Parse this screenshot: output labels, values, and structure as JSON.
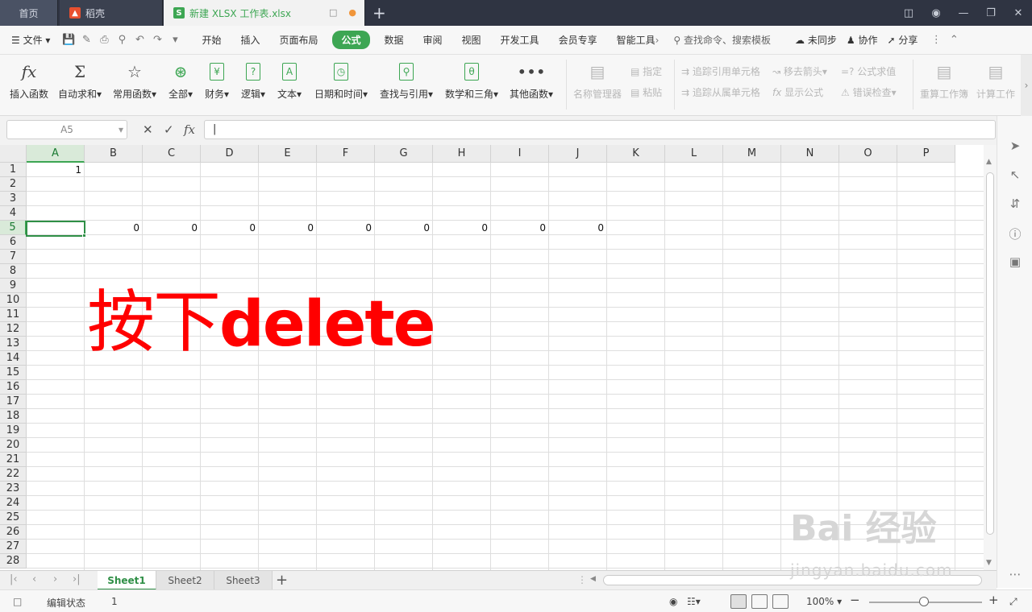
{
  "tabs": {
    "home": "首页",
    "daoke": "稻壳",
    "file": "新建 XLSX 工作表.xlsx"
  },
  "menu": {
    "file": "文件",
    "items": [
      "开始",
      "插入",
      "页面布局",
      "公式",
      "数据",
      "审阅",
      "视图",
      "开发工具",
      "会员专享",
      "智能工具箱"
    ],
    "active": "公式",
    "search": "查找命令、搜索模板",
    "sync": "未同步",
    "collab": "协作",
    "share": "分享"
  },
  "ribbon": {
    "insert_func": "插入函数",
    "autosum": "自动求和",
    "common": "常用函数",
    "all": "全部",
    "finance": "财务",
    "logic": "逻辑",
    "text": "文本",
    "datetime": "日期和时间",
    "lookup": "查找与引用",
    "math": "数学和三角",
    "other": "其他函数",
    "name_mgr": "名称管理器",
    "define": "指定",
    "paste": "粘贴",
    "trace_prec": "追踪引用单元格",
    "trace_dep": "追踪从属单元格",
    "remove_arrows": "移去箭头",
    "show_formula": "显示公式",
    "eval_formula": "公式求值",
    "error_check": "错误检查",
    "recalc_sheet": "重算工作簿",
    "calc_sheet": "计算工作"
  },
  "formula_bar": {
    "name_box": "A5",
    "value": ""
  },
  "columns": [
    "A",
    "B",
    "C",
    "D",
    "E",
    "F",
    "G",
    "H",
    "I",
    "J",
    "K",
    "L",
    "M",
    "N",
    "O",
    "P"
  ],
  "rows": [
    "1",
    "2",
    "3",
    "4",
    "5",
    "6",
    "7",
    "8",
    "9",
    "10",
    "11",
    "12",
    "13",
    "14",
    "15",
    "16",
    "17",
    "18",
    "19",
    "20",
    "21",
    "22",
    "23",
    "24",
    "25",
    "26",
    "27",
    "28"
  ],
  "cells": {
    "A1": "1",
    "B5": "0",
    "C5": "0",
    "D5": "0",
    "E5": "0",
    "F5": "0",
    "G5": "0",
    "H5": "0",
    "I5": "0",
    "J5": "0"
  },
  "overlay": {
    "cn": "按下",
    "en": "delete",
    "color": "#ff0000"
  },
  "sheets": [
    "Sheet1",
    "Sheet2",
    "Sheet3"
  ],
  "active_sheet": "Sheet1",
  "status": {
    "mode": "编辑状态",
    "value": "1",
    "zoom": "100%"
  },
  "watermark": {
    "logo": "Bai 经验",
    "url": "jingyan.baidu.com"
  },
  "colors": {
    "accent": "#3da653",
    "titlebar": "#2f3442"
  }
}
